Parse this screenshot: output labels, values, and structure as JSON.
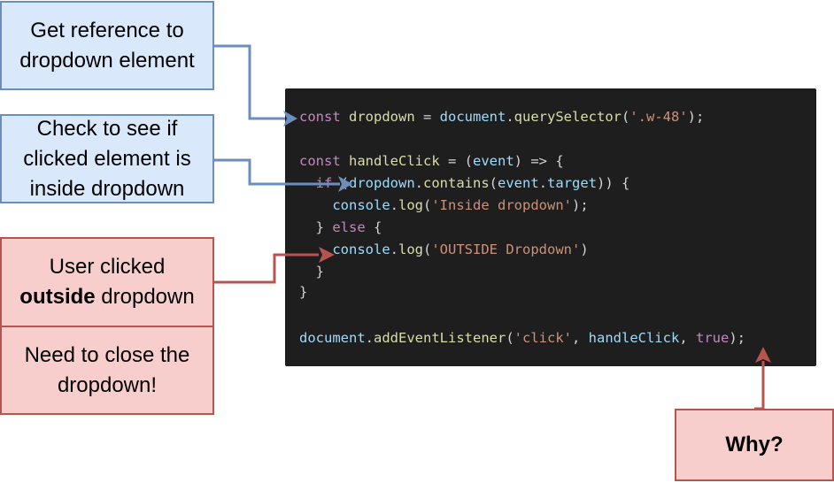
{
  "annotations": {
    "get_reference": [
      "Get reference to",
      "dropdown element"
    ],
    "check_inside": [
      "Check to see if",
      "clicked element is",
      "inside dropdown"
    ],
    "user_clicked": {
      "line1": "User clicked",
      "bold": "outside",
      "rest": " dropdown"
    },
    "need_close": [
      "Need to close the",
      "dropdown!"
    ],
    "why": "Why?"
  },
  "code": {
    "line1": {
      "kw": "const",
      "var": "dropdown",
      "eq": " = ",
      "obj": "document",
      "dot": ".",
      "fn": "querySelector",
      "open": "(",
      "str": "'.w-48'",
      "close": ");"
    },
    "line3": {
      "kw": "const",
      "var": "handleClick",
      "eq": " = (",
      "param": "event",
      "rest": ") => {"
    },
    "line4": {
      "kw": "if",
      "open": " (",
      "obj": "dropdown",
      "dot": ".",
      "fn": "contains",
      "p1": "(",
      "arg": "event",
      "dot2": ".",
      "prop": "target",
      "close": ")) {"
    },
    "line5": {
      "obj": "console",
      "dot": ".",
      "fn": "log",
      "open": "(",
      "str": "'Inside dropdown'",
      "close": ");"
    },
    "line6": {
      "pre": "} ",
      "kw": "else",
      "post": " {"
    },
    "line7": {
      "obj": "console",
      "dot": ".",
      "fn": "log",
      "open": "(",
      "str": "'OUTSIDE Dropdown'",
      "close": ")"
    },
    "line8": "}",
    "line9": "}",
    "line11": {
      "obj": "document",
      "dot": ".",
      "fn": "addEventListener",
      "open": "(",
      "str": "'click'",
      "comma": ", ",
      "arg": "handleClick",
      "comma2": ", ",
      "kw": "true",
      "close": ");"
    }
  },
  "colors": {
    "blue_fill": "#dae8fc",
    "blue_stroke": "#6c8ebf",
    "red_fill": "#f8cecc",
    "red_stroke": "#b85450",
    "code_bg": "#1e1e1e"
  }
}
